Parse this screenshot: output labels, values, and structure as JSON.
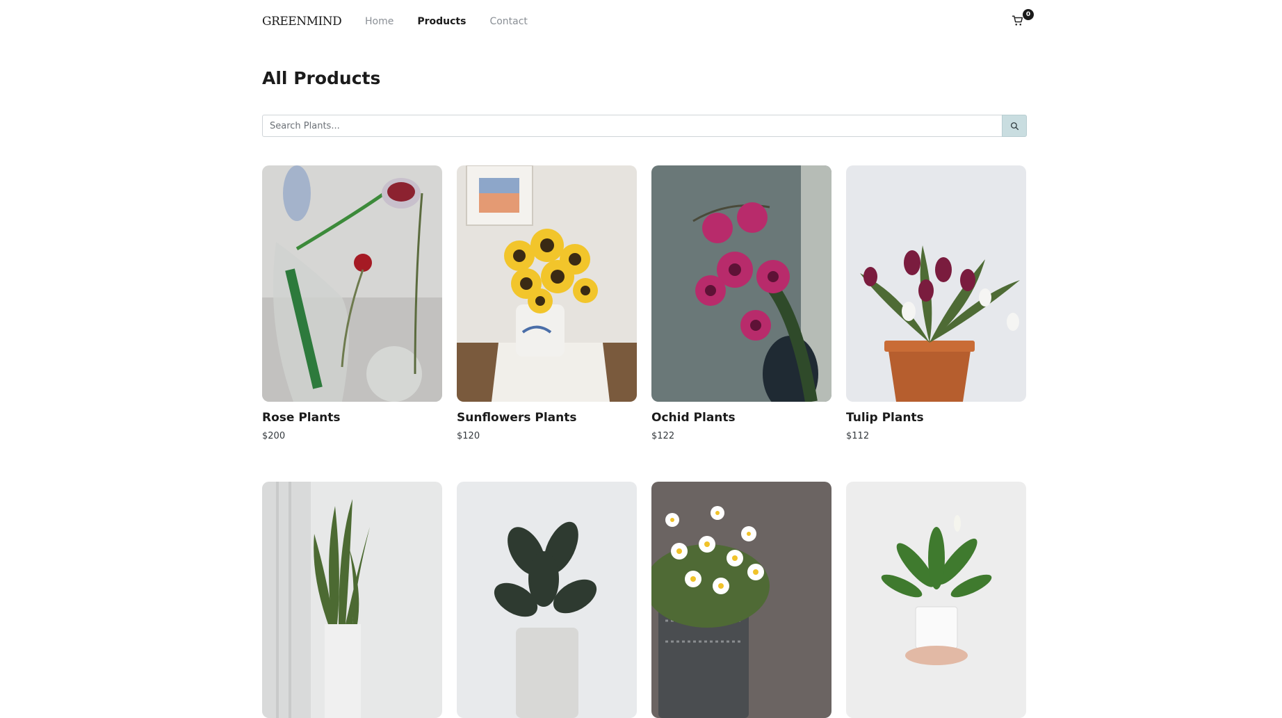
{
  "header": {
    "logo": "GREENMIND",
    "nav": [
      {
        "label": "Home"
      },
      {
        "label": "Products"
      },
      {
        "label": "Contact"
      }
    ],
    "cart_count": "0"
  },
  "page": {
    "title": "All Products"
  },
  "search": {
    "placeholder": "Search Plants...",
    "value": ""
  },
  "products": [
    {
      "name": "Rose Plants",
      "price": "$200"
    },
    {
      "name": "Sunflowers Plants",
      "price": "$120"
    },
    {
      "name": "Ochid Plants",
      "price": "$122"
    },
    {
      "name": "Tulip Plants",
      "price": "$112"
    },
    {
      "name": "",
      "price": ""
    },
    {
      "name": "",
      "price": ""
    },
    {
      "name": "",
      "price": ""
    },
    {
      "name": "",
      "price": ""
    }
  ],
  "icons": {
    "cart": "shopping-cart-icon",
    "search": "magnifier-icon"
  },
  "colors": {
    "search_button": "#c9dde0",
    "active_nav": "#1b1b1b",
    "inactive_nav": "#8a8f95"
  }
}
